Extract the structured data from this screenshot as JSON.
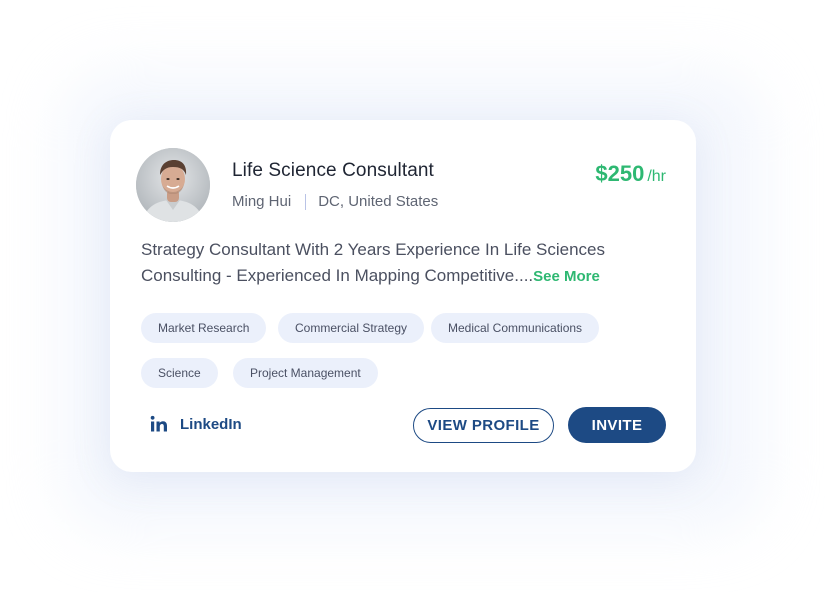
{
  "profile": {
    "title": "Life Science Consultant",
    "name": "Ming Hui",
    "location": "DC, United States",
    "rate_amount": "$250",
    "rate_unit": "/hr",
    "description": "Strategy Consultant With 2 Years Experience In Life Sciences Consulting - Experienced In Mapping Competitive....",
    "see_more_label": "See More"
  },
  "tags": [
    "Market Research",
    "Commercial Strategy",
    "Medical Communications",
    "Science",
    "Project Management"
  ],
  "actions": {
    "linkedin_label": "LinkedIn",
    "view_profile_label": "VIEW PROFILE",
    "invite_label": "INVITE"
  },
  "icons": {
    "linkedin": "linkedin-icon",
    "avatar": "avatar-photo"
  },
  "colors": {
    "accent_green": "#2eb872",
    "brand_navy": "#1d4a84",
    "tag_bg": "#ebf0fb"
  }
}
